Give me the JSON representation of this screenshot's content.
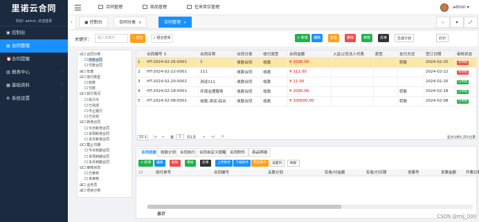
{
  "sidebar": {
    "brand": "里诺云合同",
    "welcome": "你好! admin, 欢迎登录",
    "items": [
      {
        "label": "控制台",
        "icon": "dashboard-icon",
        "active": false,
        "arrow": ""
      },
      {
        "label": "合同管理",
        "icon": "contract-icon",
        "active": true,
        "arrow": ""
      },
      {
        "label": "合同提醒",
        "icon": "bell-icon",
        "active": false,
        "arrow": ""
      },
      {
        "label": "报表中心",
        "icon": "report-icon",
        "active": false,
        "arrow": "›"
      },
      {
        "label": "基础资料",
        "icon": "database-icon",
        "active": false,
        "arrow": "›"
      },
      {
        "label": "系统设置",
        "icon": "settings-icon",
        "active": false,
        "arrow": "›"
      }
    ]
  },
  "topbar": {
    "menu": [
      "合同管理",
      "商品管理",
      "往来单位管理"
    ],
    "user": "admin"
  },
  "tabs": {
    "items": [
      "控制台",
      "合同分类",
      "合同管理"
    ],
    "close": "×"
  },
  "toolbar": {
    "keyword_label": "关键字：",
    "keyword_placeholder": "输入关键字",
    "search": "查找",
    "combo": "组合查询",
    "actions": [
      {
        "label": "+ 新增",
        "color": "#22b14c"
      },
      {
        "label": "编辑",
        "color": "#1890ff"
      },
      {
        "label": "查看",
        "color": "#ff9f1a"
      },
      {
        "label": "删除",
        "color": "#ef4b4b"
      },
      {
        "label": "审核",
        "color": "#22b14c"
      },
      {
        "label": "反审",
        "color": "#333333"
      },
      {
        "label": "生成计划",
        "color": "#ffffff"
      },
      {
        "label": "打印",
        "color": "#ffffff"
      }
    ]
  },
  "tree": {
    "nodes": [
      {
        "label": "合同分类",
        "depth": 0,
        "toggle": "⊟"
      },
      {
        "label": "收款合同",
        "depth": 1,
        "toggle": "",
        "sel": true
      },
      {
        "label": "付款合同",
        "depth": 1,
        "toggle": ""
      },
      {
        "label": "年度",
        "depth": 0,
        "toggle": "⊞"
      },
      {
        "label": "收付类型",
        "depth": 0,
        "toggle": "⊟"
      },
      {
        "label": "收款",
        "depth": 1,
        "toggle": ""
      },
      {
        "label": "付款",
        "depth": 1,
        "toggle": ""
      },
      {
        "label": "执行情况",
        "depth": 0,
        "toggle": "⊟"
      },
      {
        "label": "执行中",
        "depth": 1,
        "toggle": ""
      },
      {
        "label": "已完成",
        "depth": 1,
        "toggle": ""
      },
      {
        "label": "中止履行",
        "depth": 1,
        "toggle": ""
      },
      {
        "label": "已失效",
        "depth": 1,
        "toggle": ""
      },
      {
        "label": "新增合同",
        "depth": 0,
        "toggle": "⊟"
      },
      {
        "label": "今日新增合同",
        "depth": 1,
        "toggle": ""
      },
      {
        "label": "本周新增合同",
        "depth": 1,
        "toggle": ""
      },
      {
        "label": "本月新增合同",
        "depth": 1,
        "toggle": ""
      },
      {
        "label": "截止日期",
        "depth": 0,
        "toggle": "⊟"
      },
      {
        "label": "今日到期合同",
        "depth": 1,
        "toggle": ""
      },
      {
        "label": "本周到期合同",
        "depth": 1,
        "toggle": ""
      },
      {
        "label": "本月到期合同",
        "depth": 1,
        "toggle": ""
      },
      {
        "label": "审核状态",
        "depth": 0,
        "toggle": "⊟"
      },
      {
        "label": "已审核",
        "depth": 1,
        "toggle": ""
      },
      {
        "label": "未审核",
        "depth": 1,
        "toggle": ""
      },
      {
        "label": "业务员",
        "depth": 0,
        "toggle": "⊞"
      },
      {
        "label": "项目分类",
        "depth": 0,
        "toggle": "⊞"
      }
    ]
  },
  "grid": {
    "columns": [
      "",
      "合同编号 ⇕",
      "合同名称",
      "合同分类",
      "收付类型",
      "合同金额",
      "入驻公司法人代表",
      "类型",
      "支付方式",
      "签订日期",
      "审核状态"
    ],
    "rows": [
      {
        "no": "1",
        "code": "HT-2024-02-25-0001",
        "name": "1",
        "cat": "收款合同",
        "type": "收款",
        "amount": "¥ 2000.00",
        "rep": "",
        "kind": "",
        "pay": "转账",
        "date": "2024-02-25",
        "status": "未审核",
        "status_color": "#ef4b4b",
        "sel": true
      },
      {
        "no": "2",
        "code": "HT-2024-02-22-0001",
        "name": "111",
        "cat": "收款合同",
        "type": "收款",
        "amount": "¥ 111.00",
        "rep": "",
        "kind": "",
        "pay": "",
        "date": "2024-02-22",
        "status": "未审核",
        "status_color": "#ef4b4b",
        "sel": false
      },
      {
        "no": "3",
        "code": "HT-2024-02-20-0002",
        "name": "测试111",
        "cat": "收款合同",
        "type": "收款",
        "amount": "¥ 11.00",
        "rep": "",
        "kind": "",
        "pay": "",
        "date": "2024-02-20",
        "status": "已审核",
        "status_color": "#22b14c",
        "sel": false
      },
      {
        "no": "4",
        "code": "HT-2024-02-18-0001",
        "name": "环保治理服务",
        "cat": "收款合同",
        "type": "收款",
        "amount": "¥ 2000.00",
        "rep": "",
        "kind": "",
        "pay": "转账",
        "date": "2024-02-18",
        "status": "已审核",
        "status_color": "#22b14c",
        "sel": false
      },
      {
        "no": "5",
        "code": "HT-2024-02-08-0001",
        "name": "收款-测试-综合",
        "cat": "收款合同",
        "type": "收款",
        "amount": "¥ 100000.00",
        "rep": "",
        "kind": "",
        "pay": "转账",
        "date": "2024-02-08",
        "status": "已审核",
        "status_color": "#22b14c",
        "sel": false
      }
    ]
  },
  "pager": {
    "size": "10",
    "page_label": "第",
    "page": "1",
    "total_pages": "共1页",
    "info": "显示1到5,共5记录"
  },
  "lower": {
    "tabs": [
      "合同收款",
      "收款计划",
      "合同执行",
      "合同自定义提醒",
      "合同附件",
      "商品明细"
    ],
    "buttons": [
      {
        "label": "+ 新增",
        "color": "#22b14c"
      },
      {
        "label": "编辑",
        "color": "#1890ff"
      },
      {
        "label": "删除",
        "color": "#ef4b4b"
      },
      {
        "label": "审核",
        "color": "#22b14c"
      },
      {
        "label": "反审",
        "color": "#333333"
      },
      {
        "label": "上传附件",
        "color": "#1890ff"
      },
      {
        "label": "下载附件",
        "color": "#1890ff"
      },
      {
        "label": "预览附件",
        "color": "#ff9f1a"
      },
      {
        "label": "设置列",
        "color": "#ffffff"
      },
      {
        "label": "刷新",
        "color": "#ffffff"
      }
    ],
    "columns": [
      "收付单号",
      "合同编号",
      "关联计划",
      "实收/付金额",
      "实收/付日期",
      "发票号",
      "发票金额",
      "开票日期"
    ],
    "total": "总计"
  },
  "watermark": "CSDN @mlj_000"
}
